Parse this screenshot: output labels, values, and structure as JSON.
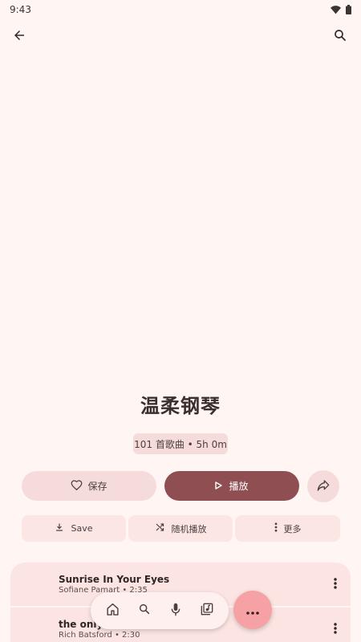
{
  "status": {
    "time": "9:43"
  },
  "playlist": {
    "title": "温柔钢琴",
    "info": "101 首歌曲 • 5h 0m"
  },
  "actions": {
    "save_label": "保存",
    "play_label": "播放",
    "download_label": "Save",
    "shuffle_label": "随机播放",
    "more_label": "更多"
  },
  "tracks": [
    {
      "title": "Sunrise In Your Eyes",
      "subtitle": "Sofiane Pamart • 2:35"
    },
    {
      "title": "the only c",
      "subtitle": "Rich Batsford • 2:30"
    }
  ],
  "colors": {
    "background": "#fff5f3",
    "accent": "#8f4e52",
    "chip": "#f5dcdb",
    "fab": "#f6a2a4"
  },
  "icons": {
    "back": "arrow-left-icon",
    "search": "search-icon",
    "heart": "heart-icon",
    "play": "play-icon",
    "share": "share-icon",
    "download": "download-icon",
    "shuffle": "shuffle-icon",
    "more": "more-vert-icon",
    "home": "home-icon",
    "mic": "mic-icon",
    "library": "library-music-icon",
    "fab": "more-horiz-icon"
  }
}
